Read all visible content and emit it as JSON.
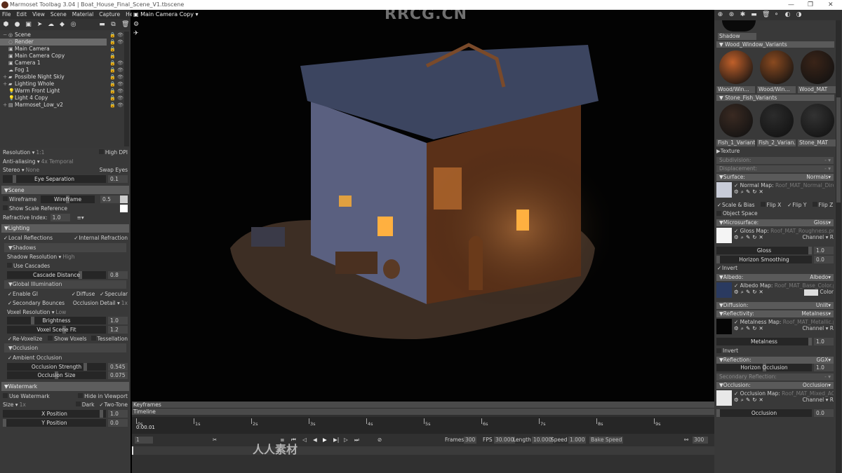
{
  "titlebar": {
    "app": "Marmoset Toolbag 3.04",
    "separator": "|",
    "file": "Boat_House_Final_Scene_V1.tbscene",
    "minimize": "—",
    "restore": "❐",
    "close": "✕"
  },
  "menu": [
    "File",
    "Edit",
    "View",
    "Scene",
    "Material",
    "Capture",
    "Help"
  ],
  "scene_tree": [
    {
      "label": "Scene",
      "icon": "◎",
      "exp": "−",
      "lock": "off",
      "eye": true
    },
    {
      "label": "Render",
      "icon": "◌",
      "exp": "",
      "lock": "off",
      "eye": true,
      "selected": true
    },
    {
      "label": "Main Camera",
      "icon": "▣",
      "exp": "",
      "lock": "off",
      "eye": false
    },
    {
      "label": "Main Camera Copy",
      "icon": "▣",
      "exp": "",
      "lock": "off",
      "eye": false
    },
    {
      "label": "Camera 1",
      "icon": "▣",
      "exp": "",
      "lock": "off",
      "eye": true
    },
    {
      "label": "Fog 1",
      "icon": "☁",
      "exp": "",
      "lock": "off",
      "eye": true
    },
    {
      "label": "Possible Night Skiy",
      "icon": "▰",
      "exp": "+",
      "lock": "off",
      "eye": true
    },
    {
      "label": "Lighting Whole",
      "icon": "▰",
      "exp": "+",
      "lock": "off",
      "eye": true
    },
    {
      "label": "Warm Front Light",
      "icon": "💡",
      "exp": "",
      "lock": "on",
      "eye": true
    },
    {
      "label": "Light 4 Copy",
      "icon": "💡",
      "exp": "",
      "lock": "on",
      "eye": true
    },
    {
      "label": "Marmoset_Low_v2",
      "icon": "▤",
      "exp": "+",
      "lock": "off",
      "eye": true
    }
  ],
  "left_rows": [
    {
      "t": "row",
      "items": [
        {
          "k": "dd",
          "label": "Resolution",
          "value": "1:1"
        },
        {
          "k": "chk",
          "checked": false,
          "label": "High DPI",
          "right": true
        }
      ]
    },
    {
      "t": "row",
      "items": [
        {
          "k": "dd",
          "label": "Anti-aliasing",
          "value": "4x Temporal"
        }
      ]
    },
    {
      "t": "row",
      "items": [
        {
          "k": "dd",
          "label": "Stereo",
          "value": "None"
        },
        {
          "k": "text",
          "label": "Swap Eyes",
          "right": true
        }
      ]
    },
    {
      "t": "slider",
      "label": "Eye Separation",
      "value": "0.1",
      "level": 0.1
    },
    {
      "t": "hdr",
      "label": "Scene"
    },
    {
      "t": "row",
      "items": [
        {
          "k": "chk",
          "checked": false,
          "label": "Wireframe"
        },
        {
          "k": "slider",
          "label": "Wireframe",
          "value": "0.5",
          "level": 0.5
        },
        {
          "k": "swatch"
        }
      ]
    },
    {
      "t": "row",
      "items": [
        {
          "k": "chk",
          "checked": false,
          "label": "Show Scale Reference"
        },
        {
          "k": "swatch",
          "white": true
        }
      ]
    },
    {
      "t": "row",
      "items": [
        {
          "k": "text",
          "label": "Refractive Index:"
        },
        {
          "k": "num",
          "value": "1.0"
        },
        {
          "k": "text",
          "label": "≡▾"
        }
      ]
    },
    {
      "t": "hdr",
      "label": "Lighting"
    },
    {
      "t": "row",
      "items": [
        {
          "k": "chk",
          "checked": true,
          "label": "Local Reflections"
        },
        {
          "k": "chk",
          "checked": true,
          "label": "Internal Refraction",
          "right": true
        }
      ]
    },
    {
      "t": "sub",
      "label": "Shadows"
    },
    {
      "t": "row",
      "ind": true,
      "items": [
        {
          "k": "dd",
          "label": "Shadow Resolution",
          "value": "High"
        }
      ]
    },
    {
      "t": "row",
      "ind": true,
      "items": [
        {
          "k": "chk",
          "checked": false,
          "label": "Use Cascades"
        }
      ]
    },
    {
      "t": "slider",
      "ind": true,
      "label": "Cascade Distance",
      "value": "0.8",
      "level": 0.75
    },
    {
      "t": "sub",
      "label": "Global Illumination"
    },
    {
      "t": "row",
      "ind": true,
      "items": [
        {
          "k": "chk",
          "checked": true,
          "label": "Enable GI"
        },
        {
          "k": "chk",
          "checked": true,
          "label": "Diffuse",
          "right": true
        },
        {
          "k": "chk",
          "checked": true,
          "label": "Specular"
        }
      ]
    },
    {
      "t": "row",
      "ind": true,
      "items": [
        {
          "k": "chk",
          "checked": true,
          "label": "Secondary Bounces"
        },
        {
          "k": "dd",
          "label": "Occlusion Detail",
          "value": "1x",
          "right": true
        }
      ]
    },
    {
      "t": "row",
      "ind": true,
      "items": [
        {
          "k": "dd",
          "label": "Voxel Resolution",
          "value": "Low"
        }
      ]
    },
    {
      "t": "slider",
      "ind": true,
      "label": "Brightness",
      "value": "1.0",
      "level": 0.25
    },
    {
      "t": "slider",
      "ind": true,
      "label": "Voxel Scene Fit",
      "value": "1.2",
      "level": 0.58
    },
    {
      "t": "row",
      "ind": true,
      "items": [
        {
          "k": "chk",
          "checked": true,
          "label": "Re-Voxelize"
        },
        {
          "k": "chk",
          "checked": false,
          "label": "Show Voxels",
          "right": true
        },
        {
          "k": "chk",
          "checked": false,
          "label": "Tessellation"
        }
      ]
    },
    {
      "t": "sub",
      "label": "Occlusion"
    },
    {
      "t": "row",
      "ind": true,
      "items": [
        {
          "k": "chk",
          "checked": true,
          "label": "Ambient Occlusion"
        }
      ]
    },
    {
      "t": "slider",
      "ind": true,
      "label": "Occlusion Strength",
      "value": "0.545",
      "level": 0.8
    },
    {
      "t": "slider",
      "ind": true,
      "label": "Occlusion Size",
      "value": "0.075",
      "level": 0.5
    },
    {
      "t": "hdr",
      "label": "Watermark"
    },
    {
      "t": "row",
      "items": [
        {
          "k": "chk",
          "checked": false,
          "label": "Use Watermark"
        },
        {
          "k": "chk",
          "checked": false,
          "label": "Hide in Viewport",
          "right": true
        }
      ]
    },
    {
      "t": "row",
      "items": [
        {
          "k": "dd",
          "label": "Size",
          "value": "1x"
        },
        {
          "k": "chk",
          "checked": false,
          "label": "Dark",
          "right": true
        },
        {
          "k": "chk",
          "checked": true,
          "label": "Two-Tone"
        }
      ]
    },
    {
      "t": "slider",
      "label": "X Position",
      "value": "1.0",
      "level": 0.97
    },
    {
      "t": "slider",
      "label": "Y Position",
      "value": "0.0",
      "level": 0.0
    }
  ],
  "viewport": {
    "camera": "Main Camera Copy",
    "watermark_top": "RRCG.CN",
    "watermark_bottom": "人人素材"
  },
  "timeline": {
    "keyframes": "Keyframes",
    "timeline": "Timeline",
    "ticks": [
      "0s",
      "1s",
      "2s",
      "3s",
      "4s",
      "5s",
      "6s",
      "7s",
      "8s",
      "9s"
    ],
    "current_time": "0:00.01",
    "frame": "1",
    "frames_label": "Frames",
    "frames": "300",
    "fps_label": "FPS",
    "fps": "30.000",
    "length_label": "Length",
    "length": "10.000",
    "speed_label": "Speed",
    "speed": "1.000",
    "bake_speed": "Bake Speed",
    "end_frame": "300"
  },
  "materials": {
    "shadow": "Shadow",
    "groups": [
      {
        "name": "Wood_Window_Variants",
        "items": [
          {
            "label": "Wood/Win...",
            "color": "#c0602a"
          },
          {
            "label": "Wood/Win...",
            "color": "#8a4a20"
          },
          {
            "label": "Wood_MAT",
            "color": "#3a2418"
          }
        ]
      },
      {
        "name": "Stone_Fish_Variants",
        "items": [
          {
            "label": "Fish_1_Variant",
            "color": "#3a2a22"
          },
          {
            "label": "Fish_2_Varian...",
            "color": "#2c2c2c"
          },
          {
            "label": "Stone_MAT",
            "color": "#333333"
          }
        ]
      }
    ]
  },
  "properties": {
    "texture": "Texture",
    "subdivision": "Subdivision:",
    "displacement": "Displacement:",
    "surface": {
      "label": "Surface:",
      "mode": "Normals",
      "map_label": "Normal Map:",
      "map": "Roof_MAT_Normal_DirectX",
      "opts": [
        {
          "label": "Scale & Bias",
          "checked": true
        },
        {
          "label": "Flip X",
          "checked": false
        },
        {
          "label": "Flip Y",
          "checked": true
        },
        {
          "label": "Flip Z",
          "checked": false
        }
      ],
      "object_space": "Object Space"
    },
    "microsurface": {
      "label": "Microsurface:",
      "mode": "Gloss",
      "map_label": "Gloss Map:",
      "map": "Roof_MAT_Roughness.png",
      "channel": "Channel ▾ R",
      "gloss": "Gloss",
      "gloss_value": "1.0",
      "gloss_level": 1.0,
      "horizon": "Horizon Smoothing",
      "horizon_value": "0.0",
      "horizon_level": 0.0,
      "invert": "Invert"
    },
    "albedo": {
      "label": "Albedo:",
      "mode": "Albedo",
      "map_label": "Albedo Map:",
      "map": "Roof_MAT_Base_Color.png",
      "color": "Color"
    },
    "diffusion": {
      "label": "Diffusion:",
      "mode": "Unlit"
    },
    "reflectivity": {
      "label": "Reflectivity:",
      "mode": "Metalness",
      "map_label": "Metalness Map:",
      "map": "Roof_MAT_Metallic.png",
      "channel": "Channel ▾ R",
      "metal": "Metalness",
      "metal_value": "1.0",
      "metal_level": 1.0,
      "invert": "Invert"
    },
    "reflection": {
      "label": "Reflection:",
      "mode": "GGX",
      "horizon": "Horizon Occlusion",
      "horizon_value": "1.0",
      "horizon_level": 0.5
    },
    "secondary": "Secondary Reflection:",
    "occlusion": {
      "label": "Occlusion:",
      "mode": "Occlusion",
      "map_label": "Occlusion Map:",
      "map": "Roof_MAT_Mixed_AO.png",
      "channel": "Channel ▾ R",
      "occ": "Occlusion",
      "occ_value": "0.0",
      "occ_level": 0.0
    }
  }
}
